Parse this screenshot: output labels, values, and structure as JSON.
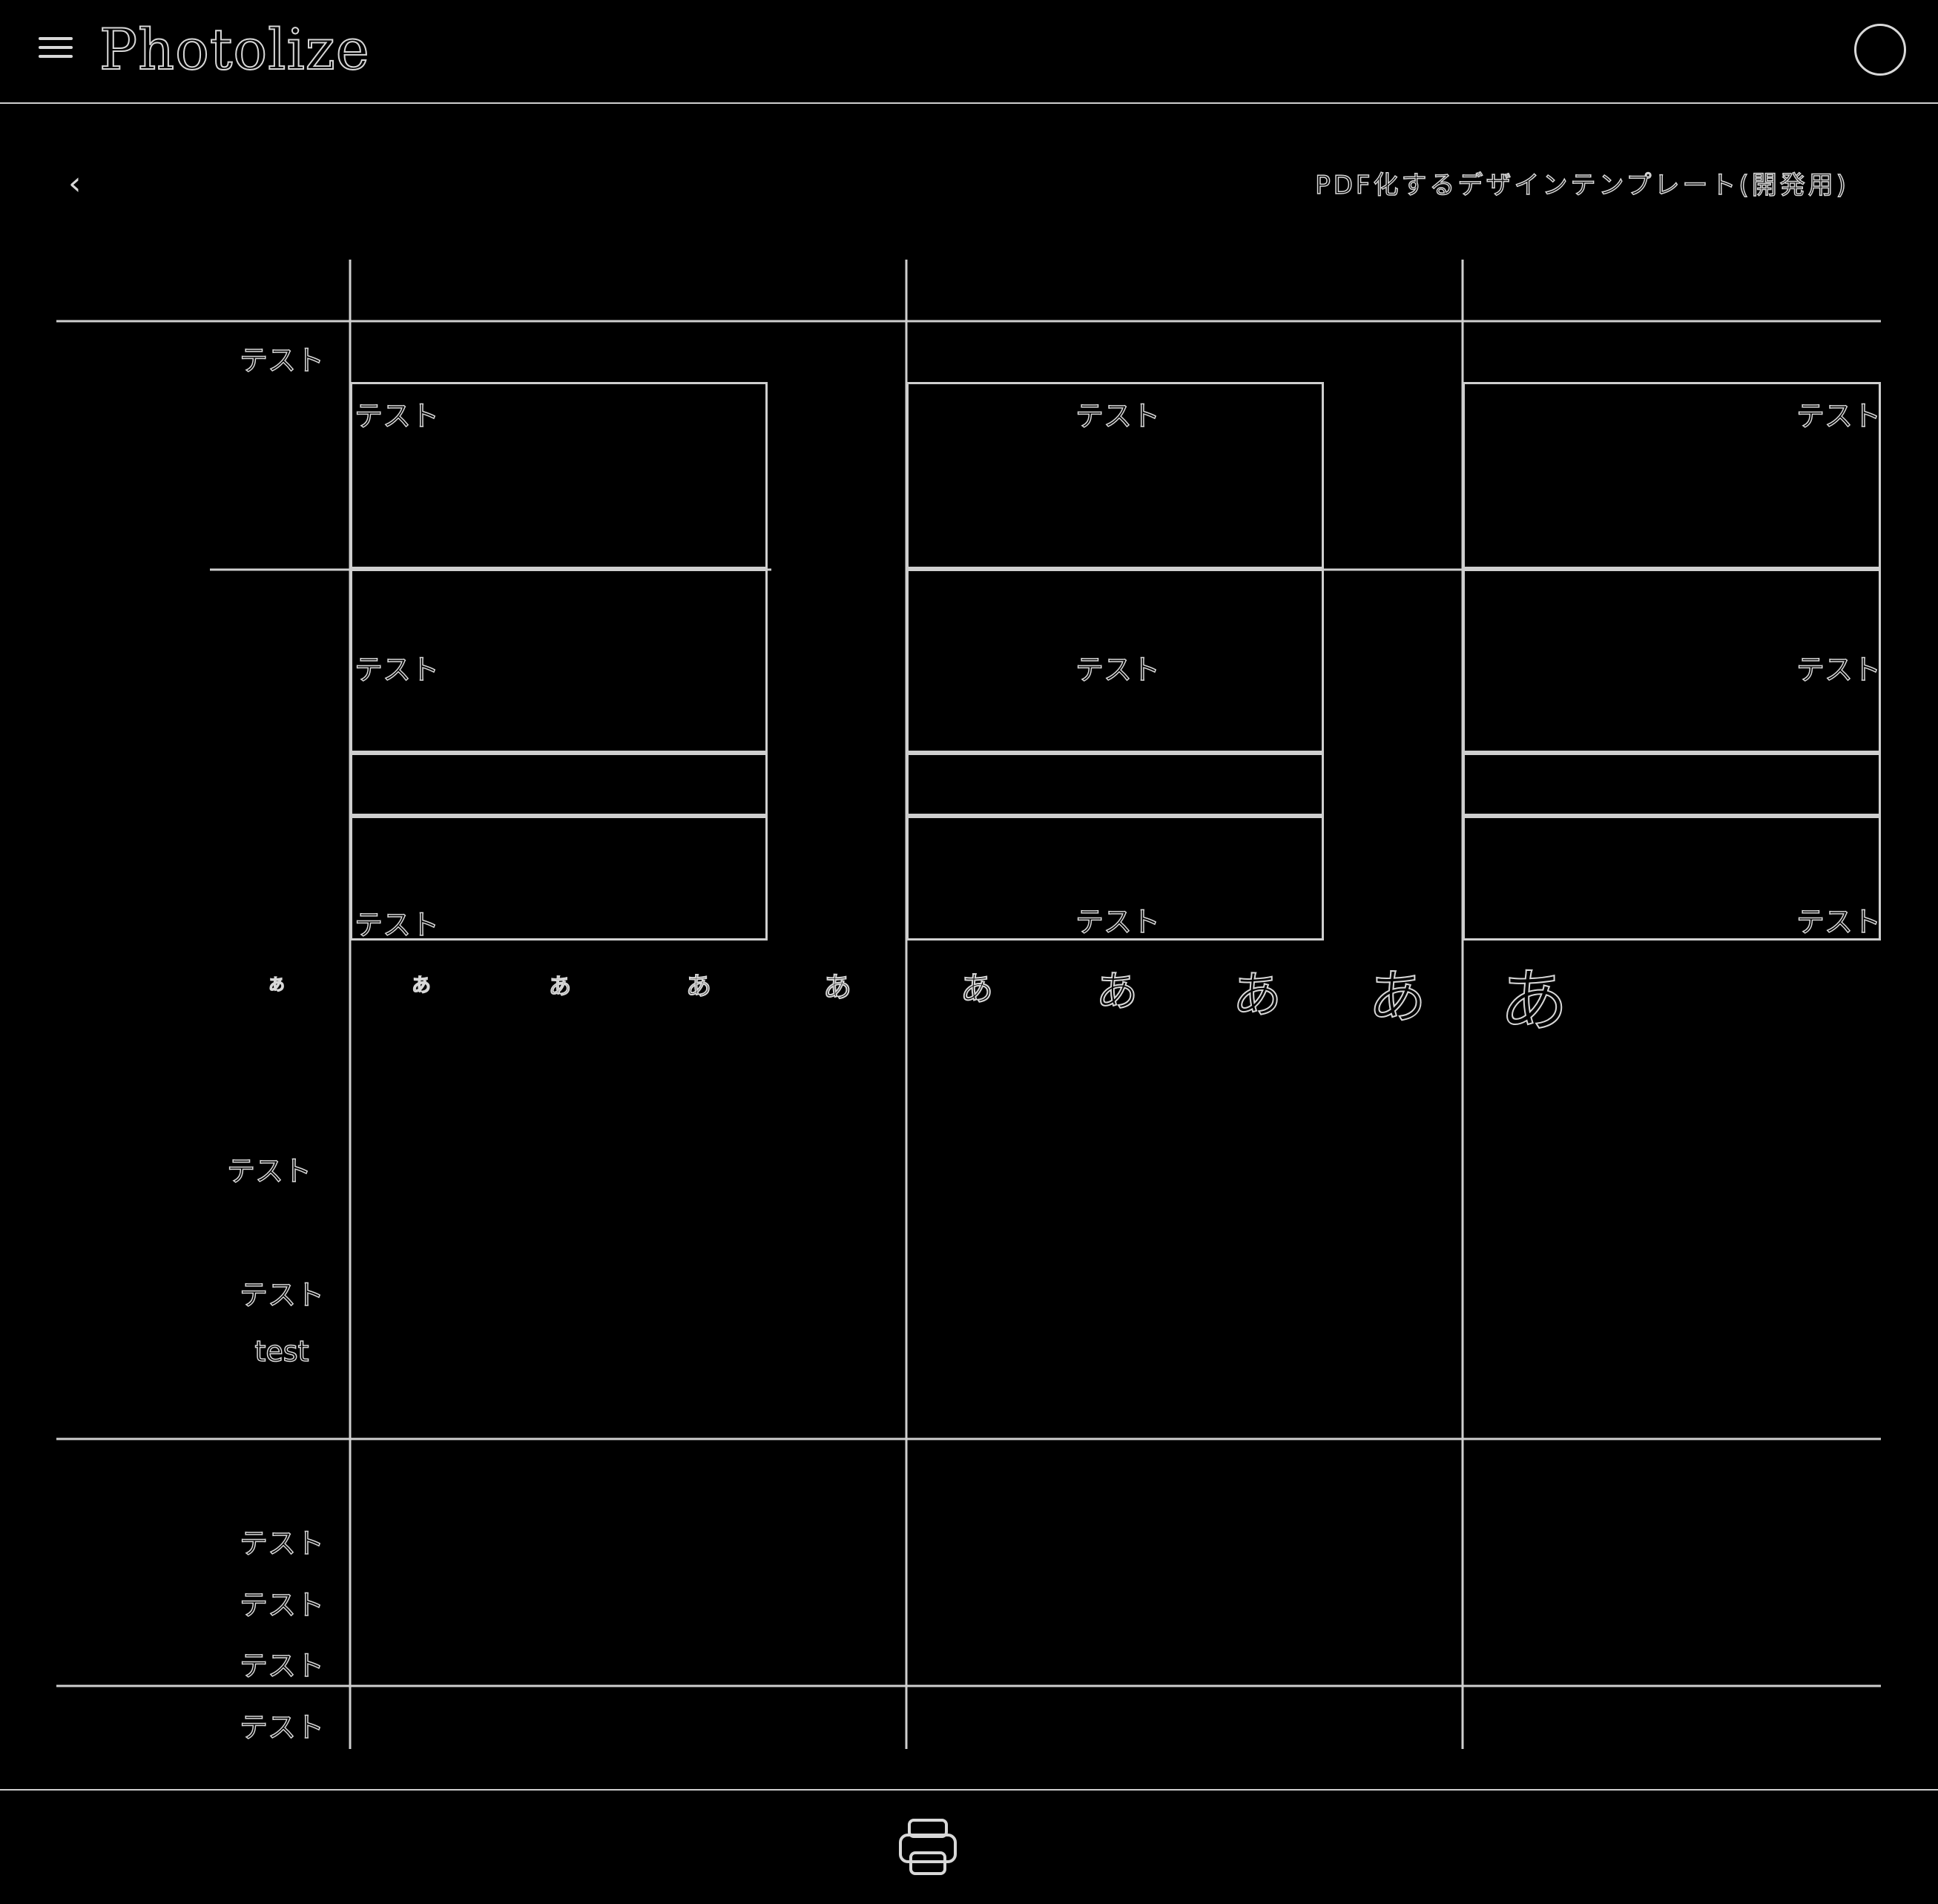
{
  "header": {
    "app_name": "Photolize"
  },
  "toolbar": {
    "back_icon": "chevron-left-icon",
    "title": "PDF化するデザインテンプレート(開発用)"
  },
  "row_values": [
    {
      "value": "テスト"
    },
    {
      "value": "テスト"
    },
    {
      "value": "テスト"
    },
    {
      "value": "test"
    },
    {
      "value": "テスト"
    },
    {
      "value": "テスト"
    },
    {
      "value": "テスト"
    },
    {
      "value": "テスト"
    }
  ],
  "boxes": [
    {
      "label": "テスト"
    },
    {
      "label": "テスト"
    },
    {
      "label": "テスト"
    },
    {
      "label": "テスト"
    },
    {
      "label": "テスト"
    },
    {
      "label": "テスト"
    },
    {
      "label": "テスト"
    },
    {
      "label": "テスト"
    },
    {
      "label": "テスト"
    }
  ],
  "font_samples": [
    "あ",
    "あ",
    "あ",
    "あ",
    "あ",
    "あ",
    "あ",
    "あ",
    "あ",
    "あ"
  ],
  "footer": {
    "print_icon": "printer-icon"
  }
}
